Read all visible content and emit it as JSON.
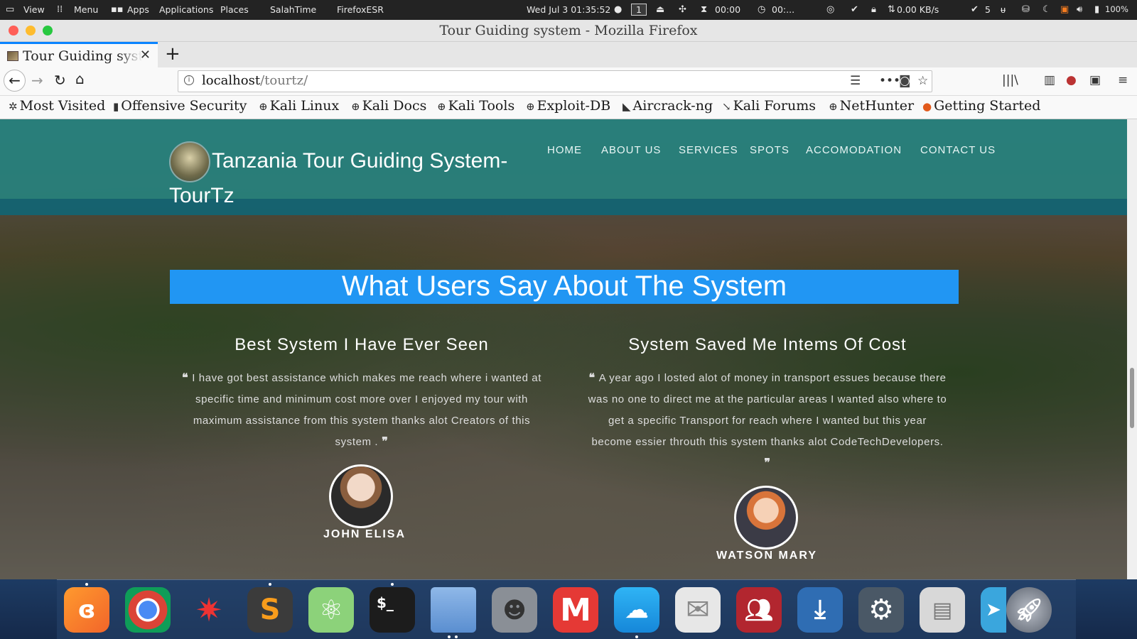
{
  "system_panel": {
    "view": "View",
    "menu": "Menu",
    "apps": "Apps",
    "applications": "Applications",
    "places": "Places",
    "salah_time": "SalahTime",
    "firefox_esr": "FirefoxESR",
    "datetime": "Wed Jul 3  01:35:52",
    "workspace": "1",
    "timer1": "00:00",
    "timer2": "00:...",
    "net_speed": "0.00 KB/s",
    "updates": "5",
    "battery": "100%"
  },
  "window": {
    "title": "Tour Guiding system - Mozilla Firefox"
  },
  "tab": {
    "label": "Tour Guiding system"
  },
  "address": {
    "host": "localhost",
    "path": "/tourtz/"
  },
  "bookmarks": [
    "Most Visited",
    "Offensive Security",
    "Kali Linux",
    "Kali Docs",
    "Kali Tools",
    "Exploit-DB",
    "Aircrack-ng",
    "Kali Forums",
    "NetHunter",
    "Getting Started"
  ],
  "site": {
    "brand": "Tanzania Tour Guiding System-TourTz",
    "menu": [
      "HOME",
      "ABOUT US",
      "SERVICES",
      "SPOTS",
      "ACCOMODATION",
      "CONTACT US"
    ],
    "section_title": "What Users Say About The System",
    "testimonials": [
      {
        "title": "Best System I Have Ever Seen",
        "text": "I have got best assistance which makes me reach where i wanted at specific time and minimum cost more over I enjoyed my tour with maximum assistance from this system thanks alot Creators of this system .",
        "name": "JOHN ELISA"
      },
      {
        "title": "System Saved Me Intems Of Cost",
        "text": "A year ago I losted alot of money in transport essues because there was no one to direct me at the particular areas I wanted also where to get a specific Transport for reach where I wanted but this year become essier throuth this system thanks alot CodeTechDevelopers.",
        "name": "WATSON MARY"
      }
    ]
  },
  "colors": {
    "header_teal": "#2a8e8a",
    "banner_blue": "#2196f3",
    "tab_accent": "#0a84ff"
  },
  "dock_apps": [
    "firefox-icon",
    "chrome-icon",
    "spider-icon",
    "sublime-text-icon",
    "atom-icon",
    "terminal-icon",
    "files-icon",
    "gimp-icon",
    "mail-m-icon",
    "weather-icon",
    "mail-envelope-icon",
    "contacts-icon",
    "download-icon",
    "settings-gear-icon",
    "system-monitor-icon",
    "telegram-icon",
    "launchpad-rocket-icon"
  ]
}
